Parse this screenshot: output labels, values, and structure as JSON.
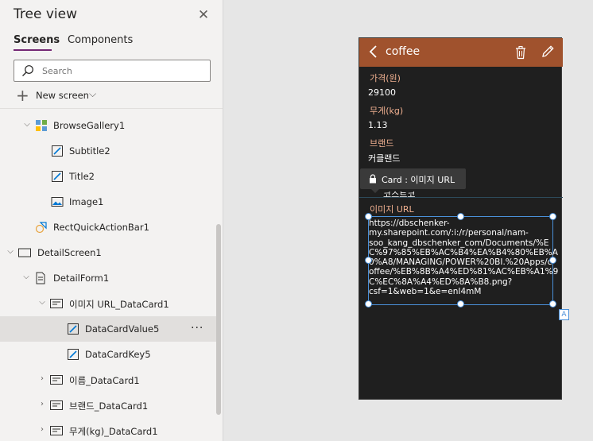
{
  "tree_view": {
    "title": "Tree view",
    "tabs": [
      {
        "label": "Screens",
        "active": true
      },
      {
        "label": "Components",
        "active": false
      }
    ],
    "search": {
      "placeholder": "Search",
      "value": ""
    },
    "new_screen_label": "New screen",
    "accent_color": "#742774",
    "items": [
      {
        "label": "BrowseGallery1",
        "icon": "gallery-icon",
        "expanded": true
      },
      {
        "label": "Subtitle2",
        "icon": "edit-text-icon"
      },
      {
        "label": "Title2",
        "icon": "edit-text-icon"
      },
      {
        "label": "Image1",
        "icon": "image-icon"
      },
      {
        "label": "RectQuickActionBar1",
        "icon": "shapes-icon"
      },
      {
        "label": "DetailScreen1",
        "icon": "screen-icon",
        "expanded": true
      },
      {
        "label": "DetailForm1",
        "icon": "form-icon",
        "expanded": true
      },
      {
        "label": "이미지 URL_DataCard1",
        "icon": "card-icon",
        "expanded": true
      },
      {
        "label": "DataCardValue5",
        "icon": "edit-text-icon",
        "selected": true
      },
      {
        "label": "DataCardKey5",
        "icon": "edit-text-icon"
      },
      {
        "label": "이름_DataCard1",
        "icon": "card-icon",
        "expanded": false
      },
      {
        "label": "브랜드_DataCard1",
        "icon": "card-icon",
        "expanded": false
      },
      {
        "label": "무게(kg)_DataCard1",
        "icon": "card-icon",
        "expanded": false
      }
    ],
    "more_label": "···"
  },
  "app_preview": {
    "header": {
      "title": "coffee",
      "bg_color": "#a0522d"
    },
    "fields": [
      {
        "key": "가격(원)",
        "value": "29100"
      },
      {
        "key": "무게(kg)",
        "value": "1.13"
      },
      {
        "key": "브랜드",
        "value": "커클랜드"
      }
    ],
    "tooltip": "Card : 이미지 URL",
    "partial_value": "코스트코",
    "image_url_card": {
      "key": "이미지 URL",
      "value_lines": [
        "https://dbschenker-",
        "my.sharepoint.com/:i:/r/personal/nam-",
        "soo_kang_dbschenker_com/Documents/%E",
        "C%97%85%EB%AC%B4%EA%B4%80%EB%A",
        "0%A8/MANAGING/POWER%20BI.%20Apps/c",
        "offee/%EB%8B%A4%ED%81%AC%EB%A1%9",
        "C%EC%8A%A4%ED%8A%B8.png?",
        "csf=1&web=1&e=enI4mM"
      ]
    },
    "badge": "A"
  }
}
